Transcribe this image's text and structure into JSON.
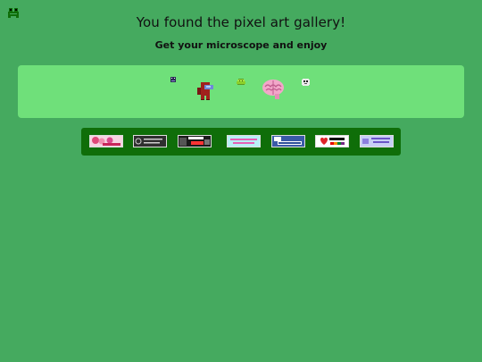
{
  "page": {
    "title": "You found the pixel art gallery!",
    "subtitle": "Get your microscope and enjoy"
  },
  "colors": {
    "background": "#45aa5f",
    "gallery_panel": "#6fe07a",
    "banner_strip": "#0f6e09"
  },
  "home": {
    "icon": "frog-icon"
  },
  "gallery": {
    "items": [
      {
        "name": "tiny-monster-pixel",
        "icon": "tiny-monster-icon"
      },
      {
        "name": "red-crewmate-pixel",
        "icon": "crewmate-icon"
      },
      {
        "name": "green-slime-pixel",
        "icon": "slime-icon"
      },
      {
        "name": "pink-brain-pixel",
        "icon": "brain-icon"
      },
      {
        "name": "ghost-face-pixel",
        "icon": "ghost-icon"
      }
    ]
  },
  "banners": [
    {
      "name": "anime-girls-88x31",
      "text": "",
      "bg": "#f2c6d8",
      "fg": "#c8265a"
    },
    {
      "name": "grey-88x31",
      "text": "",
      "bg": "#2f2f2f",
      "fg": "#cfcfcf"
    },
    {
      "name": "furry-now-88x31",
      "text": "",
      "bg": "#1a1a1a",
      "fg": "#ff3333"
    },
    {
      "name": "pastel-88x31",
      "text": "",
      "bg": "#b8f0f5",
      "fg": "#e760b6"
    },
    {
      "name": "facebook-88x31",
      "text": "",
      "bg": "#2e4f9a",
      "fg": "#ffffff"
    },
    {
      "name": "pride-now-88x31",
      "text": "",
      "bg": "#ffffff",
      "fg": "#111111"
    },
    {
      "name": "purple-88x31",
      "text": "",
      "bg": "#b9c3f2",
      "fg": "#6a55c8"
    }
  ]
}
